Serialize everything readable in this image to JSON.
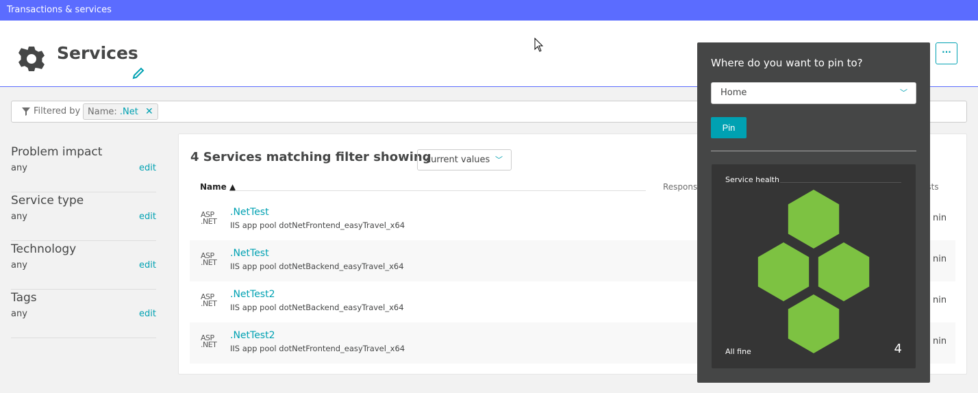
{
  "topbar": {
    "title": "Transactions & services"
  },
  "header": {
    "title": "Services",
    "more_label": "···"
  },
  "filter": {
    "label": "Filtered by",
    "chip_key": "Name:",
    "chip_value": ".Net",
    "chip_remove": "✕"
  },
  "sidebar": {
    "facets": [
      {
        "name": "Problem impact",
        "value": "any",
        "edit": "edit"
      },
      {
        "name": "Service type",
        "value": "any",
        "edit": "edit"
      },
      {
        "name": "Technology",
        "value": "any",
        "edit": "edit"
      },
      {
        "name": "Tags",
        "value": "any",
        "edit": "edit"
      }
    ]
  },
  "main": {
    "title": "4 Services matching filter showing",
    "dropdown": "current values",
    "columns": {
      "name": "Name ▲",
      "response": "Response",
      "requests": "ests"
    },
    "rows": [
      {
        "tech": "ASP\n.NET",
        "name": ".NetTest",
        "desc": "IIS app pool dotNetFrontend_easyTravel_x64",
        "req": "nin"
      },
      {
        "tech": "ASP\n.NET",
        "name": ".NetTest",
        "desc": "IIS app pool dotNetBackend_easyTravel_x64",
        "req": "nin"
      },
      {
        "tech": "ASP\n.NET",
        "name": ".NetTest2",
        "desc": "IIS app pool dotNetBackend_easyTravel_x64",
        "req": "nin"
      },
      {
        "tech": "ASP\n.NET",
        "name": ".NetTest2",
        "desc": "IIS app pool dotNetFrontend_easyTravel_x64",
        "req": "nin"
      }
    ]
  },
  "popup": {
    "question": "Where do you want to pin to?",
    "selected": "Home",
    "pin_label": "Pin",
    "tile": {
      "title": "Service health",
      "status": "All fine",
      "count": "4",
      "healthy_count": 4,
      "color": "#7dc242"
    }
  },
  "colors": {
    "accent": "#00a1b2",
    "topbar": "#5b6cff",
    "popup_bg": "#454646",
    "healthy": "#7dc242"
  }
}
